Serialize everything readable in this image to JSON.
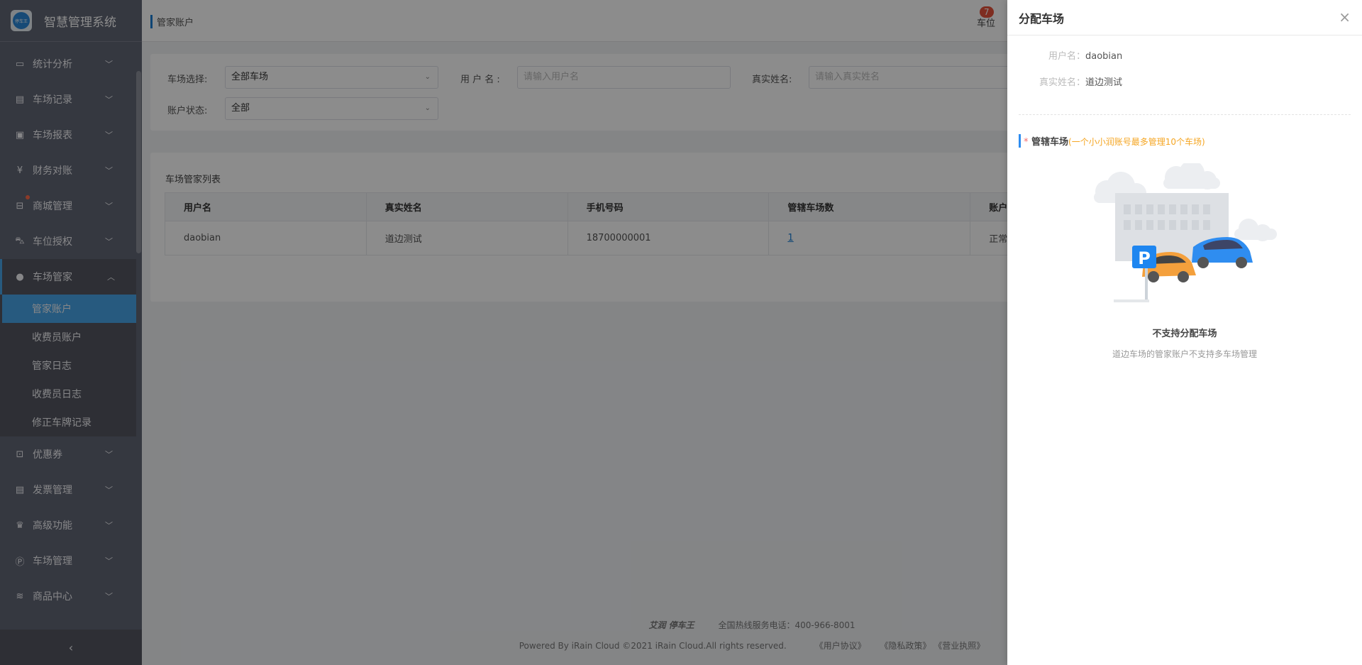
{
  "app": {
    "title": "智慧管理系统",
    "logo_text": "停车王"
  },
  "sidebar": {
    "items": [
      {
        "label": "统计分析",
        "icon": "monitor-icon"
      },
      {
        "label": "车场记录",
        "icon": "document-icon"
      },
      {
        "label": "车场报表",
        "icon": "report-icon"
      },
      {
        "label": "财务对账",
        "icon": "yen-icon"
      },
      {
        "label": "商城管理",
        "icon": "shop-icon"
      },
      {
        "label": "车位授权",
        "icon": "car-icon"
      },
      {
        "label": "车场管家",
        "icon": "user-icon"
      },
      {
        "label": "优惠券",
        "icon": "ticket-icon"
      },
      {
        "label": "发票管理",
        "icon": "invoice-icon"
      },
      {
        "label": "高级功能",
        "icon": "crown-icon"
      },
      {
        "label": "车场管理",
        "icon": "parking-icon"
      },
      {
        "label": "商品中心",
        "icon": "layers-icon"
      }
    ],
    "sub_items": [
      "管家账户",
      "收费员账户",
      "管家日志",
      "收费员日志",
      "修正车牌记录"
    ],
    "collapse": "‹"
  },
  "header": {
    "breadcrumb": "管家账户",
    "badge": "7",
    "item": "车位"
  },
  "filters": {
    "park_label": "车场选择:",
    "park_value": "全部车场",
    "user_label": "用 户 名 :",
    "user_placeholder": "请输入用户名",
    "real_label": "真实姓名:",
    "real_placeholder": "请输入真实姓名",
    "status_label": "账户状态:",
    "status_value": "全部"
  },
  "list": {
    "title": "车场管家列表",
    "columns": [
      "用户名",
      "真实姓名",
      "手机号码",
      "管辖车场数",
      "账户状态"
    ],
    "rows": [
      [
        "daobian",
        "道边测试",
        "18700000001",
        "1",
        "正常"
      ]
    ]
  },
  "footer": {
    "brand": "艾润 停车王",
    "hotline": "全国热线服务电话：400-966-8001",
    "copyright": "Powered By iRain Cloud ©2021 iRain Cloud.All rights reserved.",
    "links": [
      "《用户协议》",
      "《隐私政策》",
      "《营业执照》"
    ]
  },
  "drawer": {
    "title": "分配车场",
    "close": "×",
    "username_label": "用户名：",
    "username": "daobian",
    "realname_label": "真实姓名：",
    "realname": "道边测试",
    "section_star": "*",
    "section_title": "管辖车场",
    "section_hint": "(一个小小润账号最多管理10个车场)",
    "sign_letter": "P",
    "empty_title": "不支持分配车场",
    "empty_desc": "道边车场的管家账户不支持多车场管理"
  }
}
